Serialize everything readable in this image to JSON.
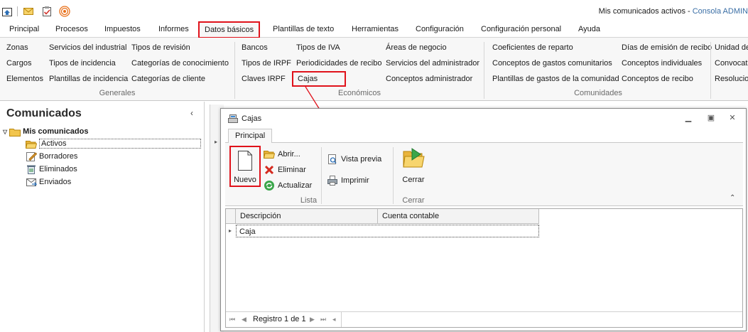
{
  "window": {
    "title": "Mis comunicados activos",
    "title_separator": " - ",
    "app_name": "Consola ADMIN"
  },
  "quick_toolbar": [
    {
      "icon": "home-icon"
    },
    {
      "icon": "mail-icon"
    },
    {
      "icon": "clipboard-icon"
    },
    {
      "icon": "broadcast-icon"
    }
  ],
  "menu": {
    "tabs": [
      "Principal",
      "Procesos",
      "Impuestos",
      "Informes",
      "Datos básicos",
      "Plantillas de texto",
      "Herramientas",
      "Configuración",
      "Configuración personal",
      "Ayuda"
    ],
    "active_index": 4
  },
  "ribbon": {
    "generales": {
      "caption": "Generales",
      "col1": [
        "Zonas",
        "Cargos",
        "Elementos"
      ],
      "col2": [
        "Servicios del industrial",
        "Tipos de incidencia",
        "Plantillas de incidencia"
      ],
      "col3": [
        "Tipos de revisión",
        "Categorías de conocimiento",
        "Categorías de cliente"
      ]
    },
    "economicos": {
      "caption": "Económicos",
      "col1": [
        "Bancos",
        "Tipos de IRPF",
        "Claves IRPF"
      ],
      "col2": [
        "Tipos de IVA",
        "Periodicidades de recibo",
        "Cajas"
      ],
      "col3": [
        "Áreas de negocio",
        "Servicios del administrador",
        "Conceptos administrador"
      ]
    },
    "comunidades": {
      "caption": "Comunidades",
      "col1": [
        "Coeficientes de reparto",
        "Conceptos de gastos comunitarios",
        "Plantillas de gastos de la comunidad"
      ],
      "col2": [
        "Días de emisión de recibo",
        "Conceptos individuales",
        "Conceptos de recibo"
      ],
      "col3": [
        "Unidad de",
        "Convocat",
        "Resolucion"
      ]
    }
  },
  "left_panel": {
    "title": "Comunicados",
    "collapse": "‹",
    "tree_root": "Mis comunicados",
    "items": [
      {
        "label": "Activos",
        "icon": "folder-open-icon"
      },
      {
        "label": "Borradores",
        "icon": "draft-icon"
      },
      {
        "label": "Eliminados",
        "icon": "trash-icon"
      },
      {
        "label": "Enviados",
        "icon": "sent-icon"
      }
    ]
  },
  "dialog": {
    "title": "Cajas",
    "tab": "Principal",
    "buttons": {
      "nuevo": "Nuevo",
      "abrir": "Abrir...",
      "eliminar": "Eliminar",
      "actualizar": "Actualizar",
      "vista_previa": "Vista previa",
      "imprimir": "Imprimir",
      "cerrar": "Cerrar"
    },
    "groups": {
      "lista": "Lista",
      "cerrar": "Cerrar"
    },
    "grid": {
      "columns": [
        "Descripción",
        "Cuenta contable"
      ],
      "rows": [
        {
          "descripcion": "Caja",
          "cuenta": ""
        }
      ]
    },
    "navigator": {
      "record_text": "Registro 1 de 1"
    }
  },
  "colors": {
    "highlight_red": "#e0121b",
    "app_blue": "#3a6ea5",
    "ribbon_bg": "#f7f7f7"
  }
}
